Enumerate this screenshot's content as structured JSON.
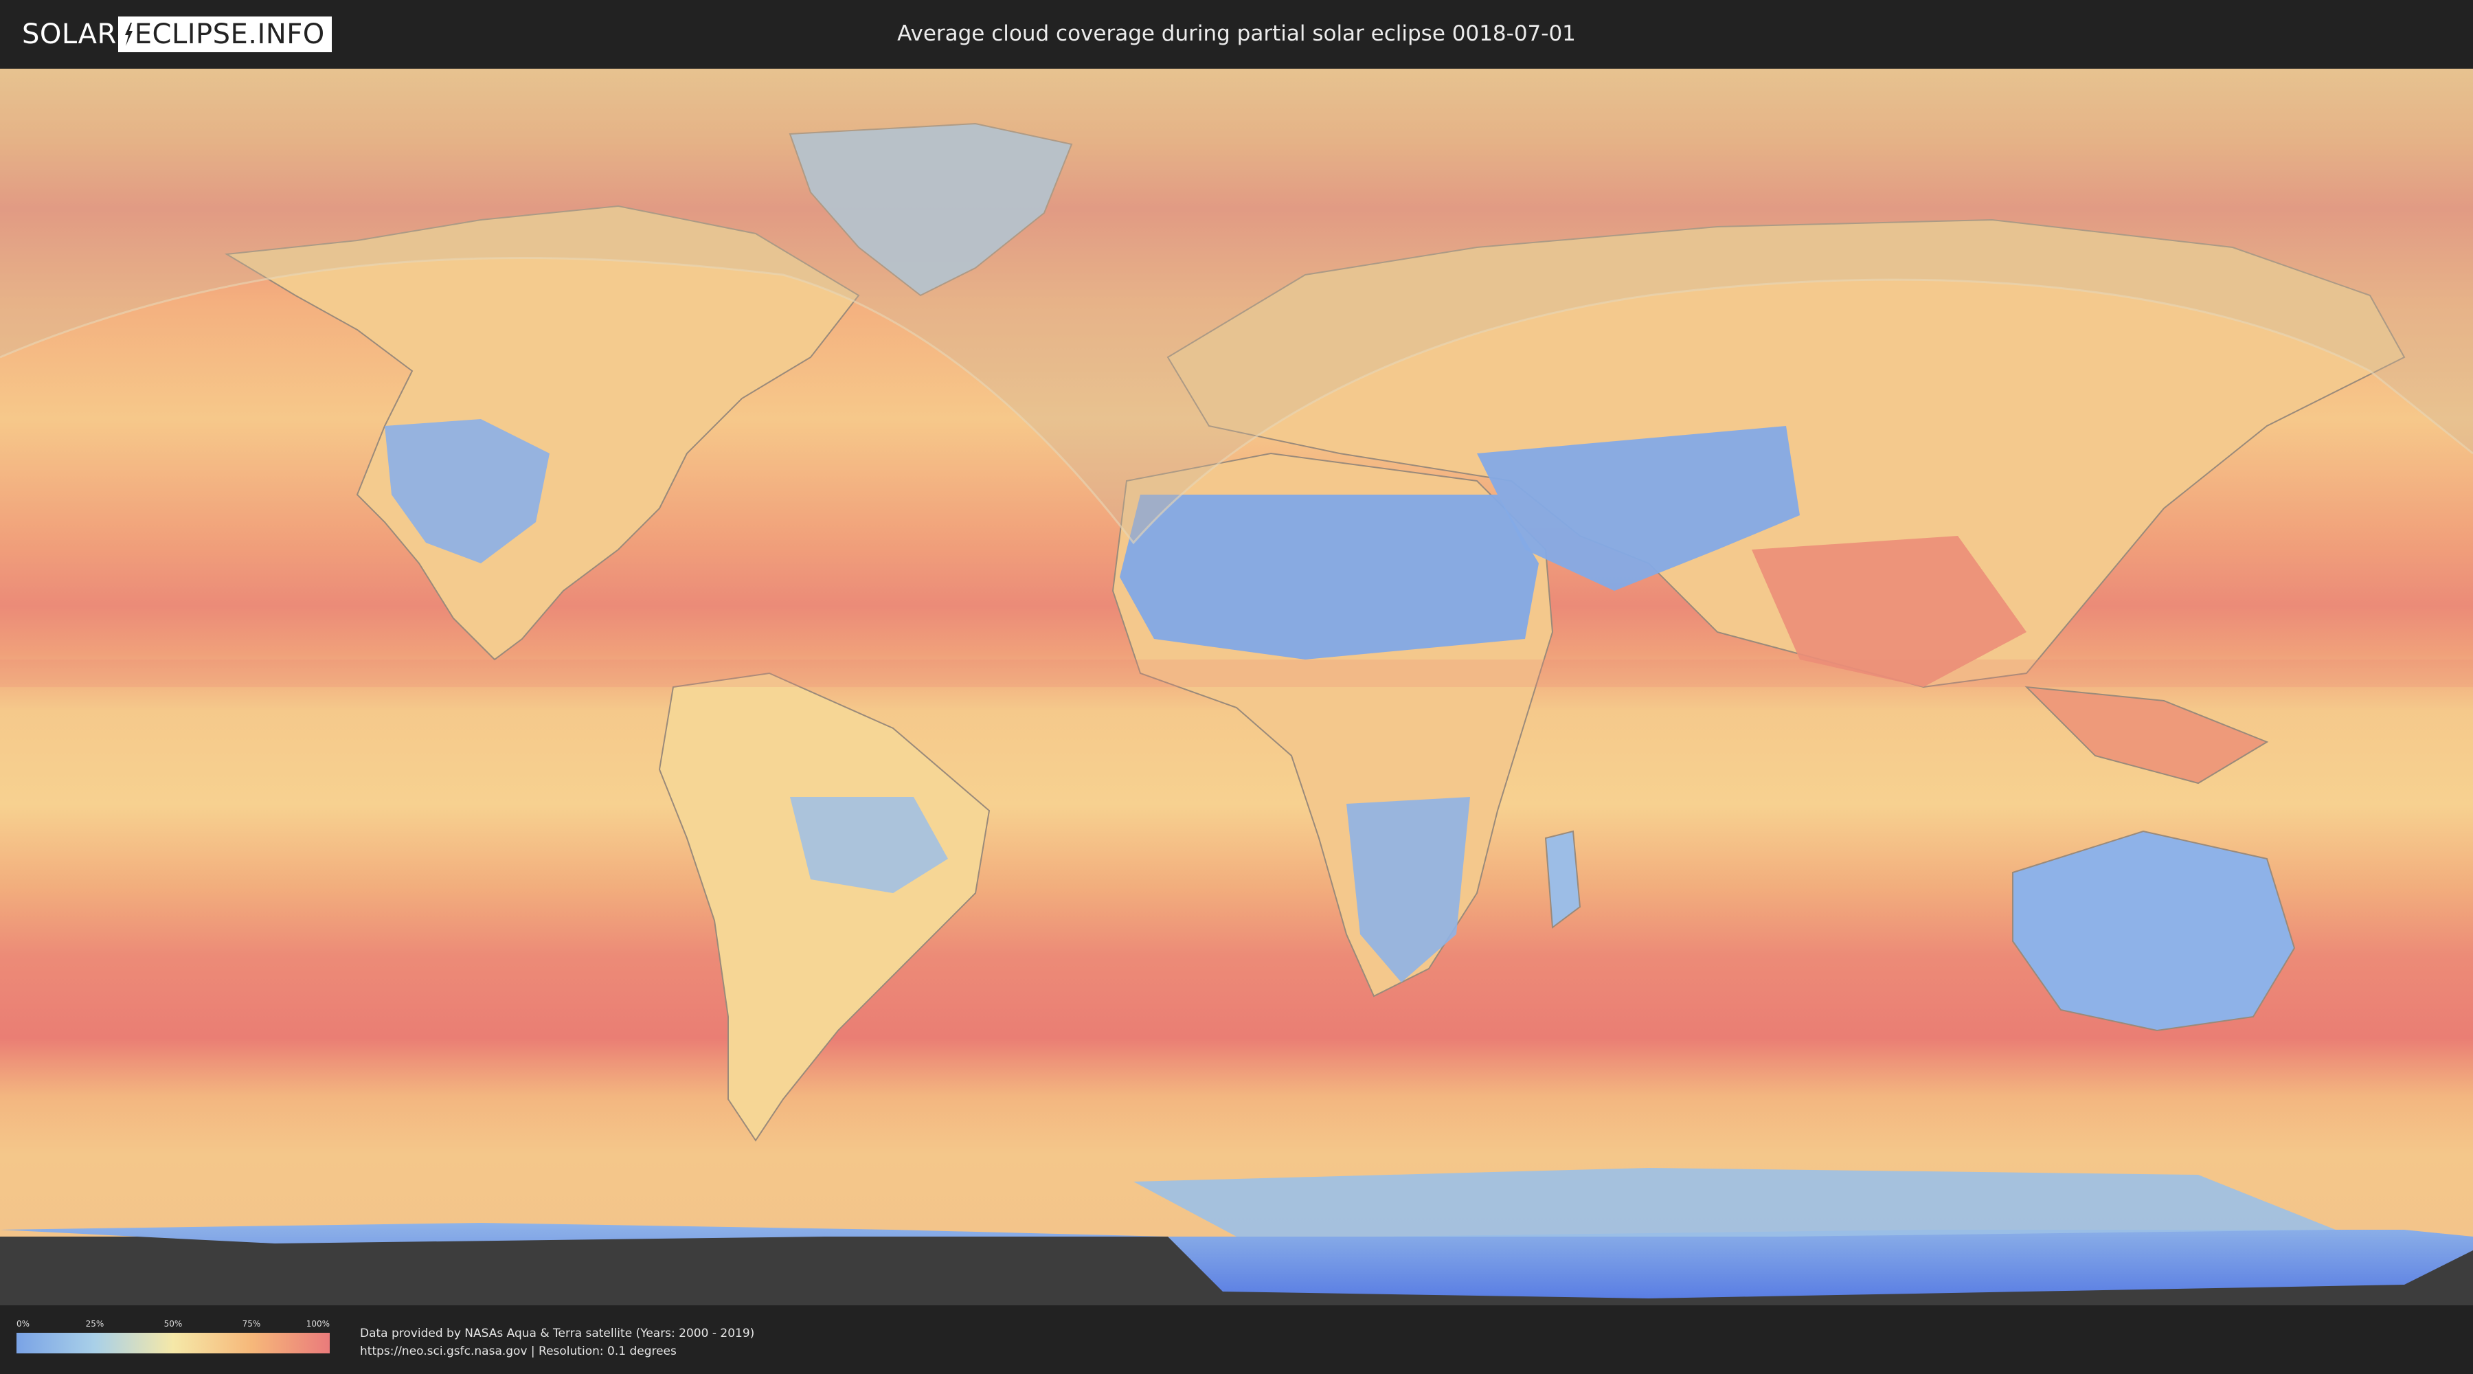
{
  "header": {
    "logo_left": "SOLAR",
    "logo_right": "ECLIPSE.INFO",
    "title": "Average cloud coverage during partial solar eclipse 0018-07-01"
  },
  "map": {
    "layer": "average-cloud-coverage",
    "visibility_overlay": "partial-eclipse-visibility-zone",
    "color_scale": {
      "low": "#7aa3e6",
      "mid_low": "#a9d0e8",
      "mid": "#f5e8a8",
      "mid_high": "#f6b87a",
      "high": "#ea7b7b"
    },
    "ocean_band_color": "#ee8a78",
    "polar_ice_color": "#5a7ee3"
  },
  "legend": {
    "labels": [
      "0%",
      "25%",
      "50%",
      "75%",
      "100%"
    ]
  },
  "footer": {
    "credit_line_1": "Data provided by NASAs Aqua & Terra satellite (Years: 2000 - 2019)",
    "credit_line_2": "https://neo.sci.gsfc.nasa.gov | Resolution: 0.1 degrees"
  }
}
